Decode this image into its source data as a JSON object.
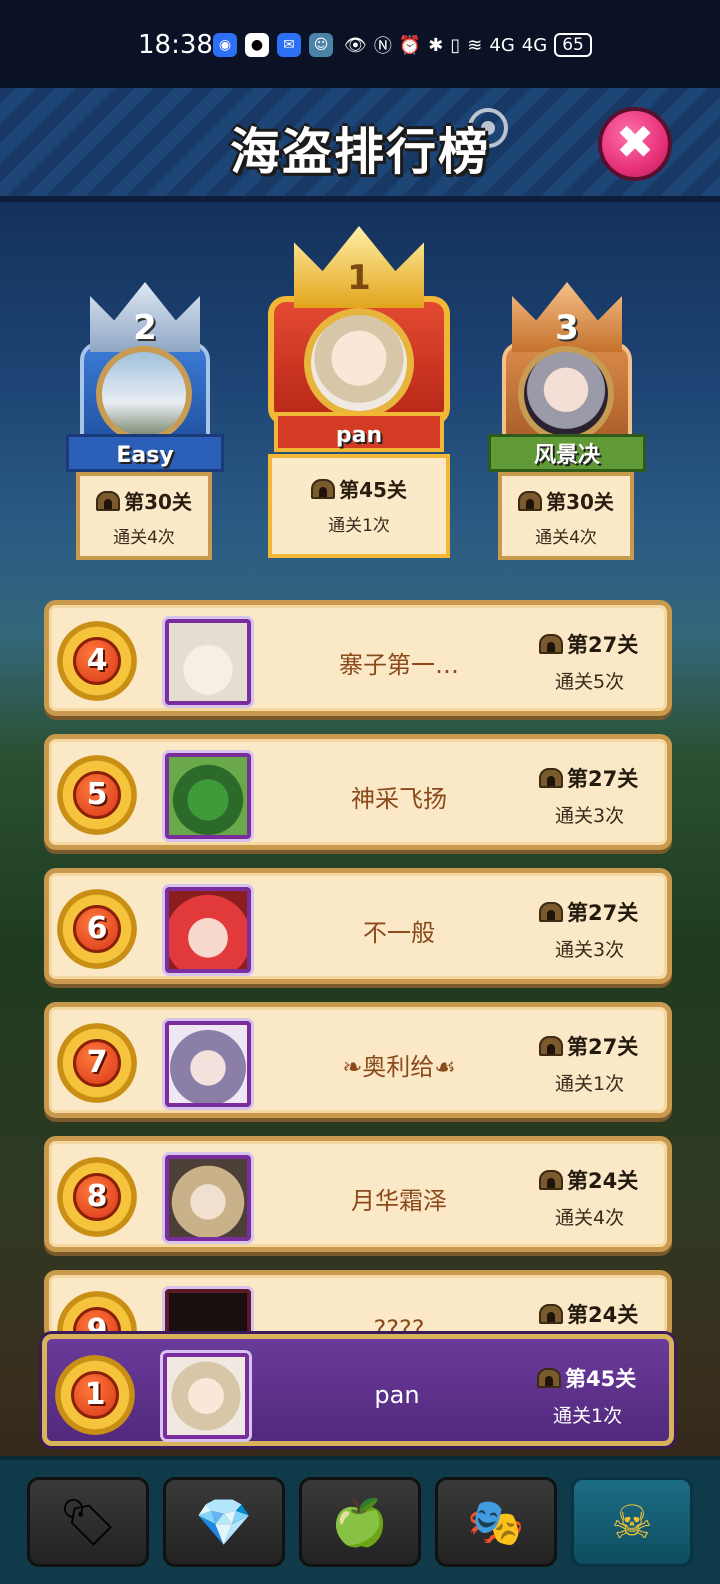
{
  "status_bar": {
    "time": "18:38",
    "battery": "65",
    "network_1": "4G",
    "network_2": "4G"
  },
  "header": {
    "title": "海盗排行榜",
    "close_icon": "close-icon"
  },
  "podium": [
    {
      "rank": "1",
      "name": "pan",
      "level": "第45关",
      "clears": "通关1次",
      "crown": "gold"
    },
    {
      "rank": "2",
      "name": "Easy",
      "level": "第30关",
      "clears": "通关4次",
      "crown": "silver"
    },
    {
      "rank": "3",
      "name": "风景决",
      "level": "第30关",
      "clears": "通关4次",
      "crown": "bronze"
    }
  ],
  "list": [
    {
      "rank": "4",
      "name": "寨子第一…",
      "level": "第27关",
      "clears": "通关5次"
    },
    {
      "rank": "5",
      "name": "神采飞扬",
      "level": "第27关",
      "clears": "通关3次"
    },
    {
      "rank": "6",
      "name": "不一般",
      "level": "第27关",
      "clears": "通关3次"
    },
    {
      "rank": "7",
      "name": "奥利给",
      "level": "第27关",
      "clears": "通关1次"
    },
    {
      "rank": "8",
      "name": "月华霜泽",
      "level": "第24关",
      "clears": "通关4次"
    },
    {
      "rank": "9",
      "name": "????",
      "level": "第24关",
      "clears": ""
    }
  ],
  "my_rank": {
    "rank": "1",
    "name": "pan",
    "level": "第45关",
    "clears": "通关1次"
  },
  "bottom_nav": [
    {
      "icon": "dog-tag-icon",
      "glyph": "🏷"
    },
    {
      "icon": "crystal-icon",
      "glyph": "💎"
    },
    {
      "icon": "fruit-icon",
      "glyph": "🍏"
    },
    {
      "icon": "demon-mask-icon",
      "glyph": "🎭"
    },
    {
      "icon": "pirate-skull-icon",
      "glyph": "☠"
    }
  ]
}
